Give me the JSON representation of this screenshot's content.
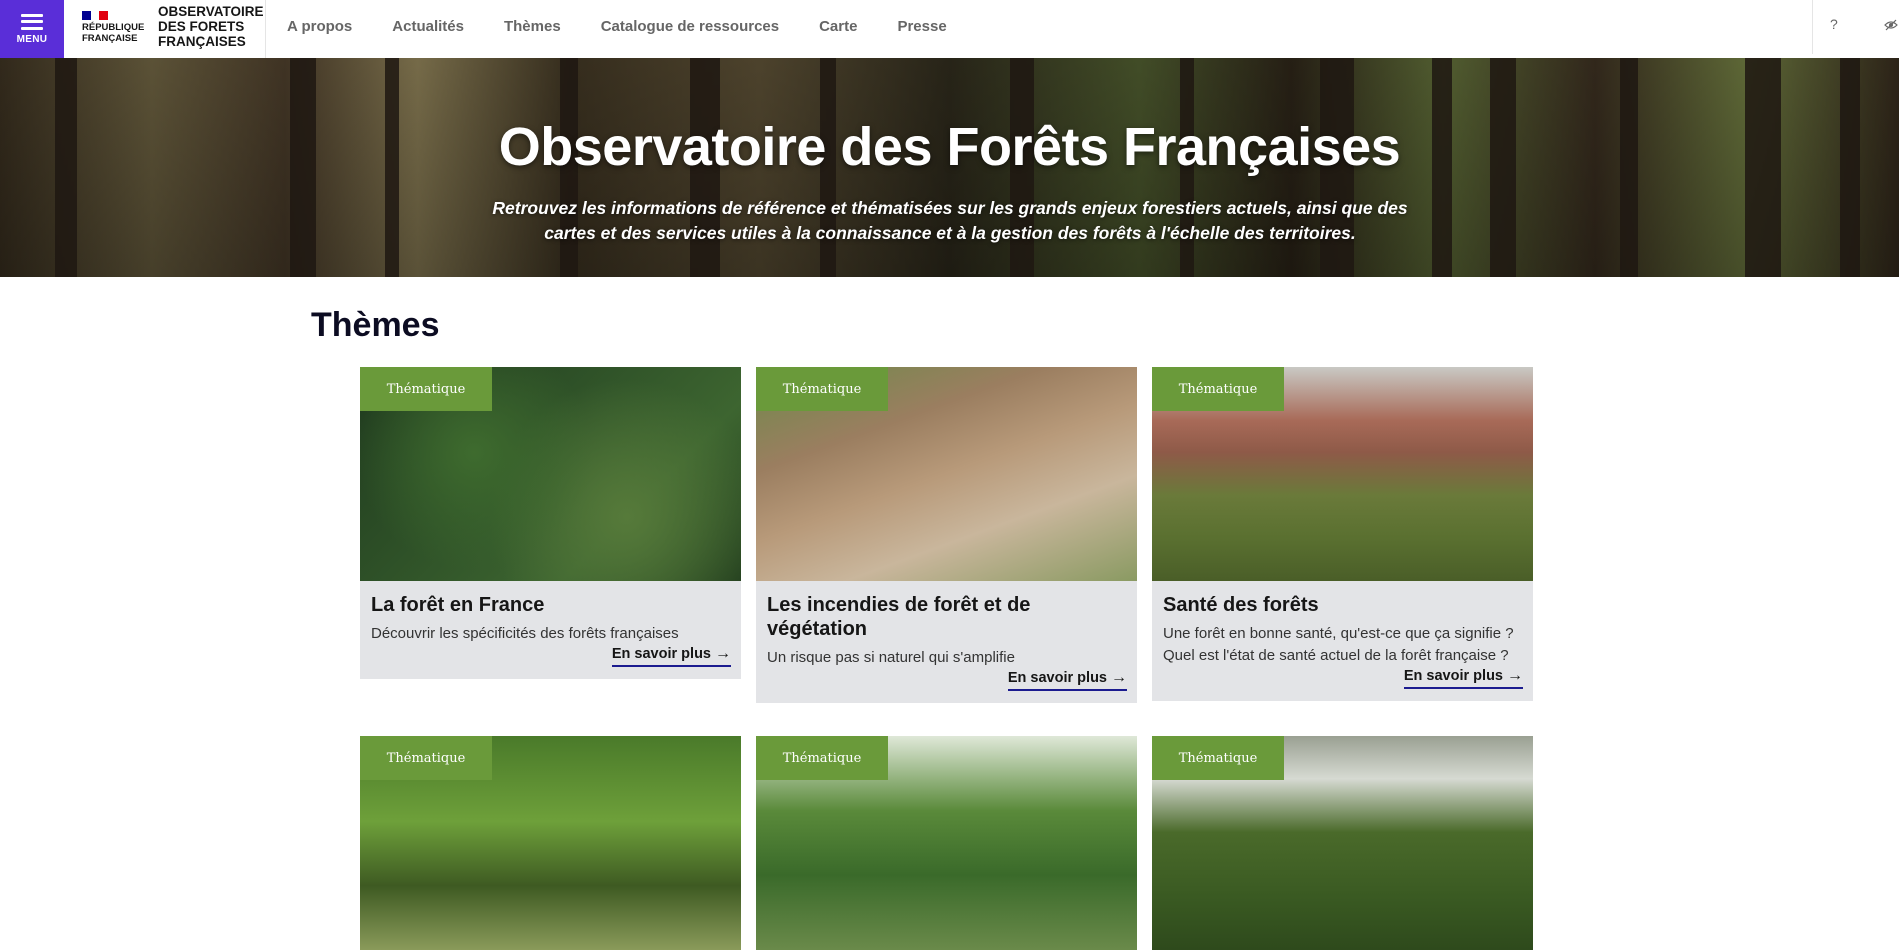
{
  "header": {
    "menu_label": "MENU",
    "republique": [
      "RÉPUBLIQUE",
      "FRANÇAISE"
    ],
    "site_name": [
      "OBSERVATOIRE",
      "DES FORETS",
      "FRANÇAISES"
    ],
    "nav": [
      "A propos",
      "Actualités",
      "Thèmes",
      "Catalogue de ressources",
      "Carte",
      "Presse"
    ],
    "help": "?"
  },
  "hero": {
    "title": "Observatoire des Forêts Françaises",
    "subtitle": "Retrouvez les informations de référence et thématisées sur les grands enjeux forestiers actuels, ainsi que des cartes et des services utiles à la connaissance et à la gestion des forêts à l'échelle des territoires."
  },
  "themes": {
    "title": "Thèmes",
    "cards": [
      {
        "tag": "Thématique",
        "title": "La forêt en France",
        "desc": "Découvrir les spécificités des forêts françaises",
        "more": "En savoir plus"
      },
      {
        "tag": "Thématique",
        "title": "Les incendies de forêt et de végétation",
        "desc": "Un risque pas si naturel qui s'amplifie",
        "more": "En savoir plus"
      },
      {
        "tag": "Thématique",
        "title": "Santé des forêts",
        "desc": "Une forêt en bonne santé, qu'est-ce que ça signifie ? Quel est l'état de santé actuel de la forêt française ?",
        "more": "En savoir plus"
      },
      {
        "tag": "Thématique"
      },
      {
        "tag": "Thématique"
      },
      {
        "tag": "Thématique"
      }
    ]
  },
  "colors": {
    "menu": "#5a2ed8",
    "tag": "#6a9a3a",
    "card_bg": "#e3e4e7",
    "link_underline": "#1b1b8f"
  }
}
